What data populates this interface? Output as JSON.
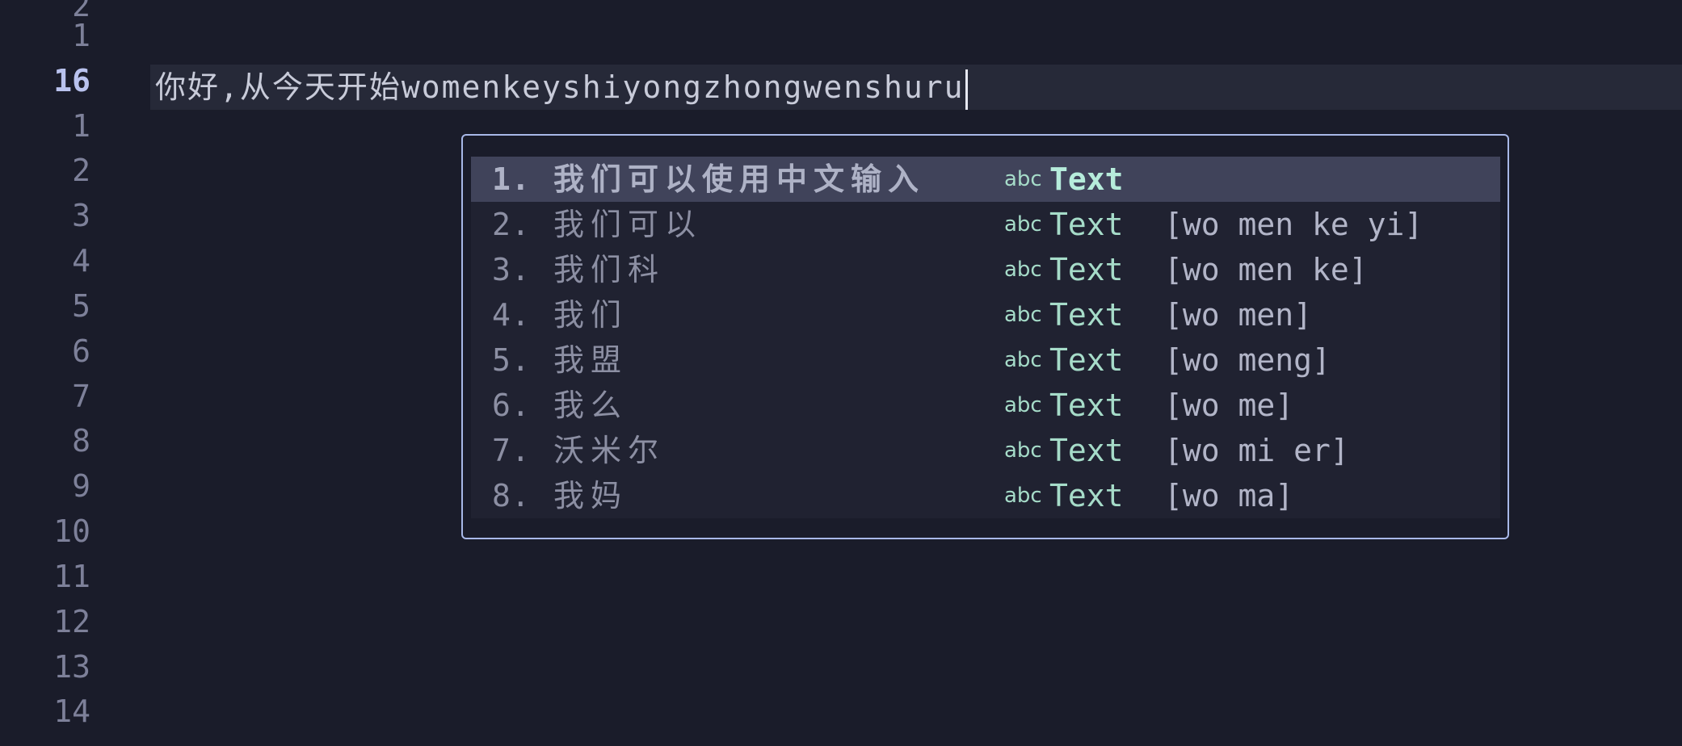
{
  "gutter": {
    "lines": [
      {
        "number": "2",
        "current": false
      },
      {
        "number": "1",
        "current": false
      },
      {
        "number": "16",
        "current": true
      },
      {
        "number": "1",
        "current": false
      },
      {
        "number": "2",
        "current": false
      },
      {
        "number": "3",
        "current": false
      },
      {
        "number": "4",
        "current": false
      },
      {
        "number": "5",
        "current": false
      },
      {
        "number": "6",
        "current": false
      },
      {
        "number": "7",
        "current": false
      },
      {
        "number": "8",
        "current": false
      },
      {
        "number": "9",
        "current": false
      },
      {
        "number": "10",
        "current": false
      },
      {
        "number": "11",
        "current": false
      },
      {
        "number": "12",
        "current": false
      },
      {
        "number": "13",
        "current": false
      },
      {
        "number": "14",
        "current": false
      }
    ]
  },
  "editor": {
    "current_line_text": "你好,从今天开始womenkeyshiyongzhongwenshuru"
  },
  "completion": {
    "kind_icon": "abc",
    "items": [
      {
        "number": "1.",
        "candidate": "我们可以使用中文输入",
        "kind": "Text",
        "pinyin": "",
        "selected": true
      },
      {
        "number": "2.",
        "candidate": "我们可以",
        "kind": "Text",
        "pinyin": "[wo men ke yi]",
        "selected": false
      },
      {
        "number": "3.",
        "candidate": "我们科",
        "kind": "Text",
        "pinyin": "[wo men ke]",
        "selected": false
      },
      {
        "number": "4.",
        "candidate": "我们",
        "kind": "Text",
        "pinyin": "[wo men]",
        "selected": false
      },
      {
        "number": "5.",
        "candidate": "我盟",
        "kind": "Text",
        "pinyin": "[wo meng]",
        "selected": false
      },
      {
        "number": "6.",
        "candidate": "我么",
        "kind": "Text",
        "pinyin": "[wo me]",
        "selected": false
      },
      {
        "number": "7.",
        "candidate": "沃米尔",
        "kind": "Text",
        "pinyin": "[wo mi er]",
        "selected": false
      },
      {
        "number": "8.",
        "candidate": "我妈",
        "kind": "Text",
        "pinyin": "[wo ma]",
        "selected": false
      }
    ]
  },
  "colors": {
    "background": "#1a1c2a",
    "cursor_line": "#262938",
    "popup_border": "#a8b8e8",
    "selected_item": "#40435a",
    "kind_accent": "#a6dcc9"
  }
}
